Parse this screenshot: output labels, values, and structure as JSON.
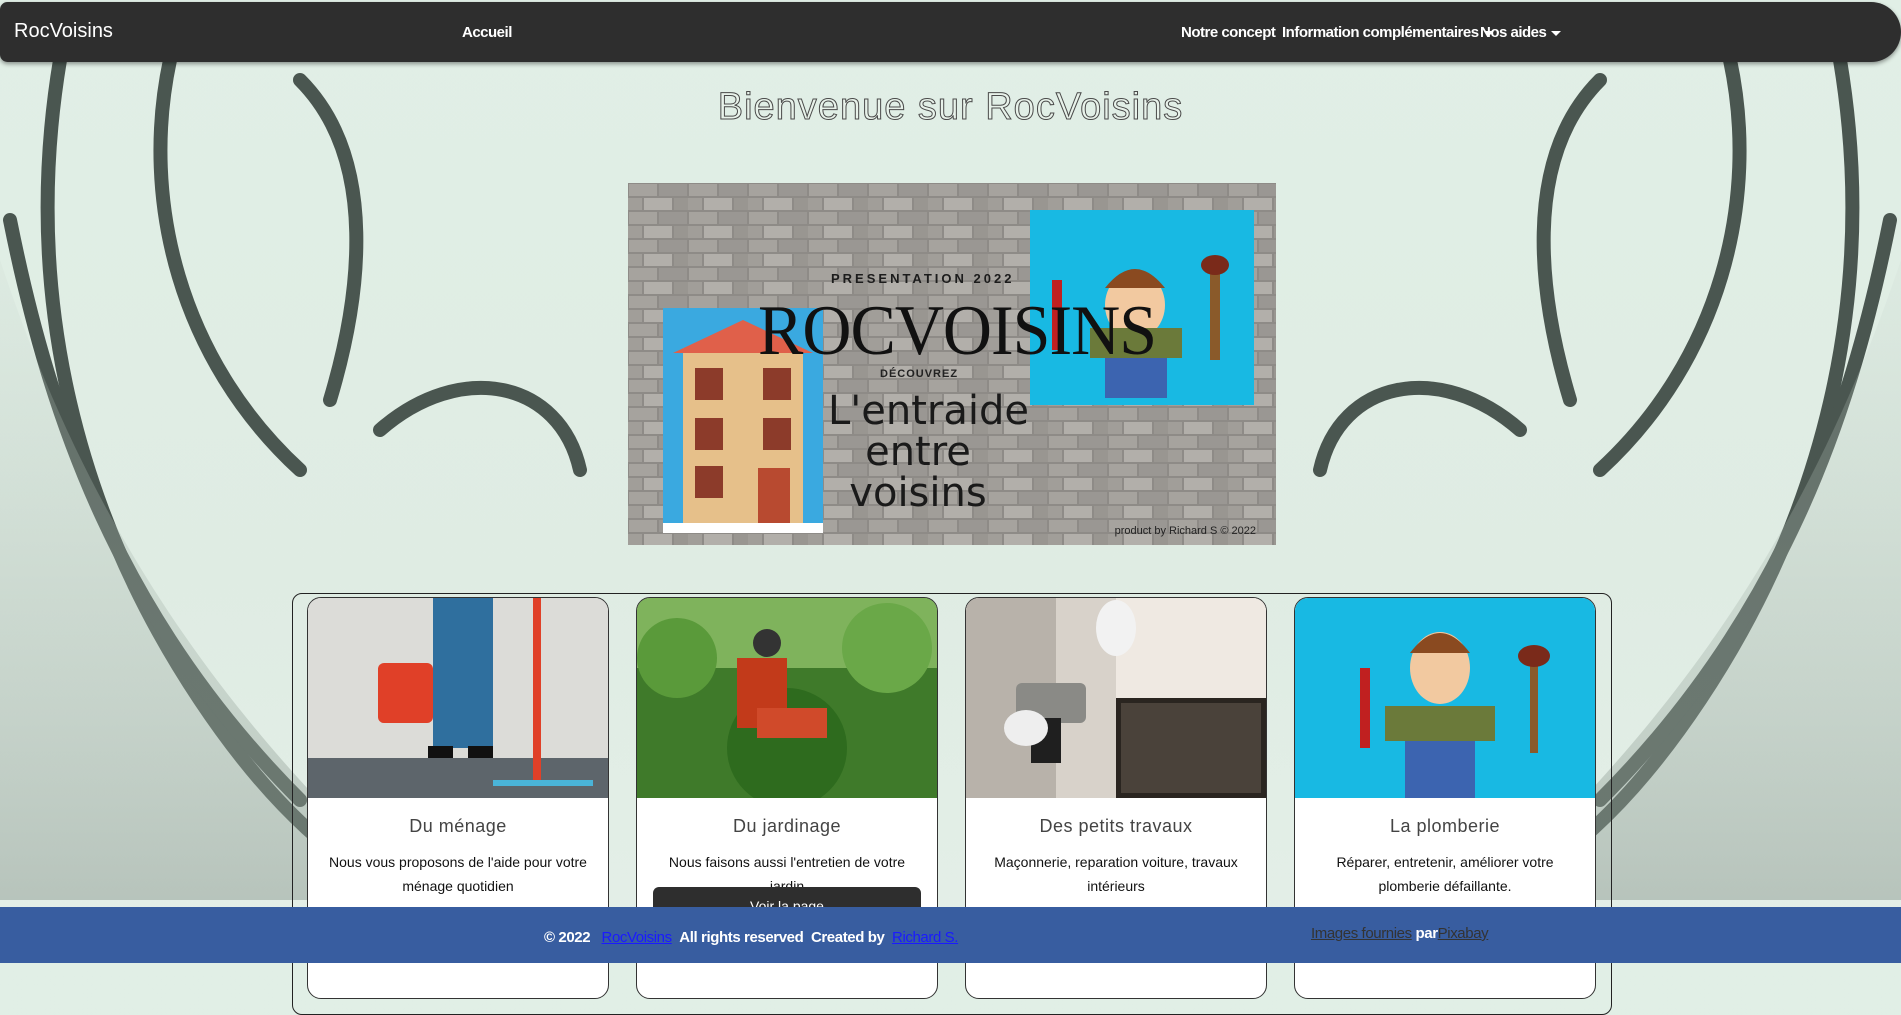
{
  "navbar": {
    "brand": "RocVoisins",
    "links": [
      {
        "label": "Accueil"
      },
      {
        "label": "Notre concept"
      },
      {
        "label": "Information complémentaires"
      },
      {
        "label": "Nos aides"
      }
    ]
  },
  "main": {
    "welcome_title": "Bienvenue sur RocVoisins",
    "banner": {
      "presentation": "PRESENTATION 2022",
      "title": "ROCVOISINS",
      "discover": "DÉCOUVREZ",
      "slogan": "L'entraide entre voisins",
      "credit": "product by Richard S © 2022"
    },
    "cards": [
      {
        "title": "Du ménage",
        "text": "Nous vous proposons de l'aide pour votre ménage quotidien",
        "image_icon": "cleaning-image"
      },
      {
        "title": "Du jardinage",
        "text": "Nous faisons aussi l'entretien de votre jardin",
        "button": "Voir la page",
        "image_icon": "gardening-image"
      },
      {
        "title": "Des petits travaux",
        "text": "Maçonnerie, reparation voiture, travaux intérieurs",
        "image_icon": "drill-image"
      },
      {
        "title": "La plomberie",
        "text": "Réparer, entretenir, améliorer votre plomberie défaillante.",
        "image_icon": "plumber-image"
      }
    ]
  },
  "footer": {
    "copyright": "© 2022",
    "site_link": "RocVoisins",
    "rights": "All rights reserved",
    "created_by": "Created by",
    "author_link": "Richard S.",
    "images_link": "Images fournies",
    "par": "par",
    "pixabay_link": "Pixabay"
  },
  "colors": {
    "navbar": "#2e2e2e",
    "footer": "#385da0",
    "background": "#e1efe6",
    "link": "#1a1aff"
  }
}
